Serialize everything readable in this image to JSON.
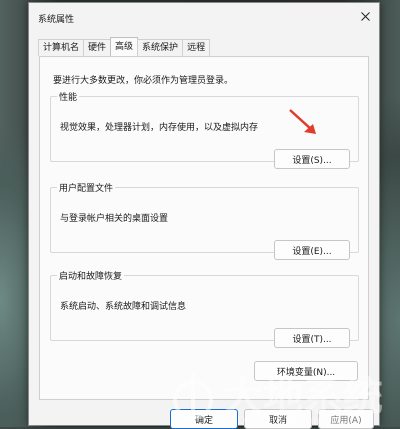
{
  "window": {
    "title": "系统属性"
  },
  "tabs": [
    {
      "label": "计算机名"
    },
    {
      "label": "硬件"
    },
    {
      "label": "高级"
    },
    {
      "label": "系统保护"
    },
    {
      "label": "远程"
    }
  ],
  "admin_note": "要进行大多数更改，你必须作为管理员登录。",
  "performance": {
    "title": "性能",
    "desc": "视觉效果，处理器计划，内存使用，以及虚拟内存",
    "button": "设置(S)..."
  },
  "user_profiles": {
    "title": "用户配置文件",
    "desc": "与登录帐户相关的桌面设置",
    "button": "设置(E)..."
  },
  "startup_recovery": {
    "title": "启动和故障恢复",
    "desc": "系统启动、系统故障和调试信息",
    "button": "设置(T)..."
  },
  "env_button": "环境变量(N)...",
  "footer": {
    "ok": "确定",
    "cancel": "取消",
    "apply": "应用(A)"
  },
  "watermark": {
    "text": "大地系统",
    "sub": "Dadixitong.com"
  },
  "colors": {
    "arrow": "#e03c2c"
  }
}
